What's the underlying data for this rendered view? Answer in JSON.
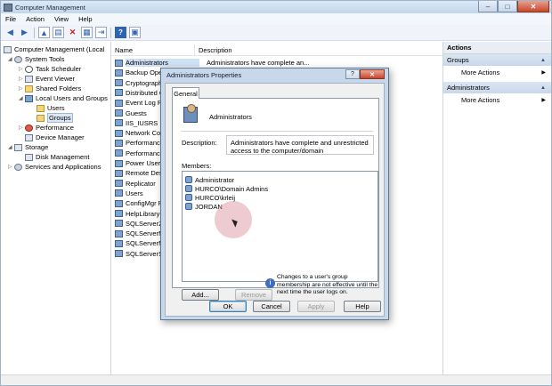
{
  "window": {
    "title": "Computer Management",
    "controls": {
      "minimize": "–",
      "maximize": "□",
      "close": "✕"
    }
  },
  "menu": [
    "File",
    "Action",
    "View",
    "Help"
  ],
  "toolbar_icons": [
    "back-arrow-icon",
    "forward-arrow-icon",
    "up-folder-icon",
    "show-hide-tree-icon",
    "delete-icon",
    "properties-icon",
    "export-icon",
    "help-icon",
    "console-icon"
  ],
  "tree": {
    "items": [
      {
        "label": "Computer Management (Local",
        "icon": "computer-icon"
      },
      {
        "label": "System Tools",
        "icon": "tools-icon"
      },
      {
        "label": "Task Scheduler",
        "icon": "clock-icon"
      },
      {
        "label": "Event Viewer",
        "icon": "event-viewer-icon"
      },
      {
        "label": "Shared Folders",
        "icon": "shared-folder-icon"
      },
      {
        "label": "Local Users and Groups",
        "icon": "users-icon"
      },
      {
        "label": "Users",
        "icon": "folder-icon"
      },
      {
        "label": "Groups",
        "icon": "folder-icon"
      },
      {
        "label": "Performance",
        "icon": "performance-icon"
      },
      {
        "label": "Device Manager",
        "icon": "device-manager-icon"
      },
      {
        "label": "Storage",
        "icon": "storage-icon"
      },
      {
        "label": "Disk Management",
        "icon": "disk-icon"
      },
      {
        "label": "Services and Applications",
        "icon": "services-icon"
      }
    ]
  },
  "list": {
    "columns": {
      "name": "Name",
      "description": "Description"
    },
    "rows": [
      {
        "name": "Administrators",
        "desc": "Administrators have complete an..."
      },
      {
        "name": "Backup Oper",
        "desc": ""
      },
      {
        "name": "Cryptograph",
        "desc": ""
      },
      {
        "name": "Distributed C",
        "desc": ""
      },
      {
        "name": "Event Log Re",
        "desc": ""
      },
      {
        "name": "Guests",
        "desc": ""
      },
      {
        "name": "IIS_IUSRS",
        "desc": ""
      },
      {
        "name": "Network Con",
        "desc": ""
      },
      {
        "name": "Performance",
        "desc": ""
      },
      {
        "name": "Performance",
        "desc": ""
      },
      {
        "name": "Power Users",
        "desc": ""
      },
      {
        "name": "Remote Desk",
        "desc": ""
      },
      {
        "name": "Replicator",
        "desc": ""
      },
      {
        "name": "Users",
        "desc": ""
      },
      {
        "name": "ConfigMgr R",
        "desc": ""
      },
      {
        "name": "HelpLibraryU",
        "desc": ""
      },
      {
        "name": "SQLServer20",
        "desc": ""
      },
      {
        "name": "SQLServerMS",
        "desc": ""
      },
      {
        "name": "SQLServerMS",
        "desc": ""
      },
      {
        "name": "SQLServerSQ",
        "desc": ""
      }
    ]
  },
  "actions": {
    "header": "Actions",
    "sections": [
      {
        "title": "Groups",
        "item": "More Actions"
      },
      {
        "title": "Administrators",
        "item": "More Actions"
      }
    ]
  },
  "dialog": {
    "title": "Administrators Properties",
    "help_btn": "?",
    "close_btn": "✕",
    "tab": "General",
    "group_name": "Administrators",
    "description_label": "Description:",
    "description": "Administrators have complete and unrestricted access to the computer/domain",
    "members_label": "Members:",
    "members": [
      "Administrator",
      "HURCO\\Domain Admins",
      "HURCO\\krleij",
      "JORDAN"
    ],
    "add_btn": "Add...",
    "remove_btn": "Remove",
    "note": "Changes to a user's group membership are not effective until the next time the user logs on.",
    "ok_btn": "OK",
    "cancel_btn": "Cancel",
    "apply_btn": "Apply",
    "helpbtn": "Help"
  }
}
